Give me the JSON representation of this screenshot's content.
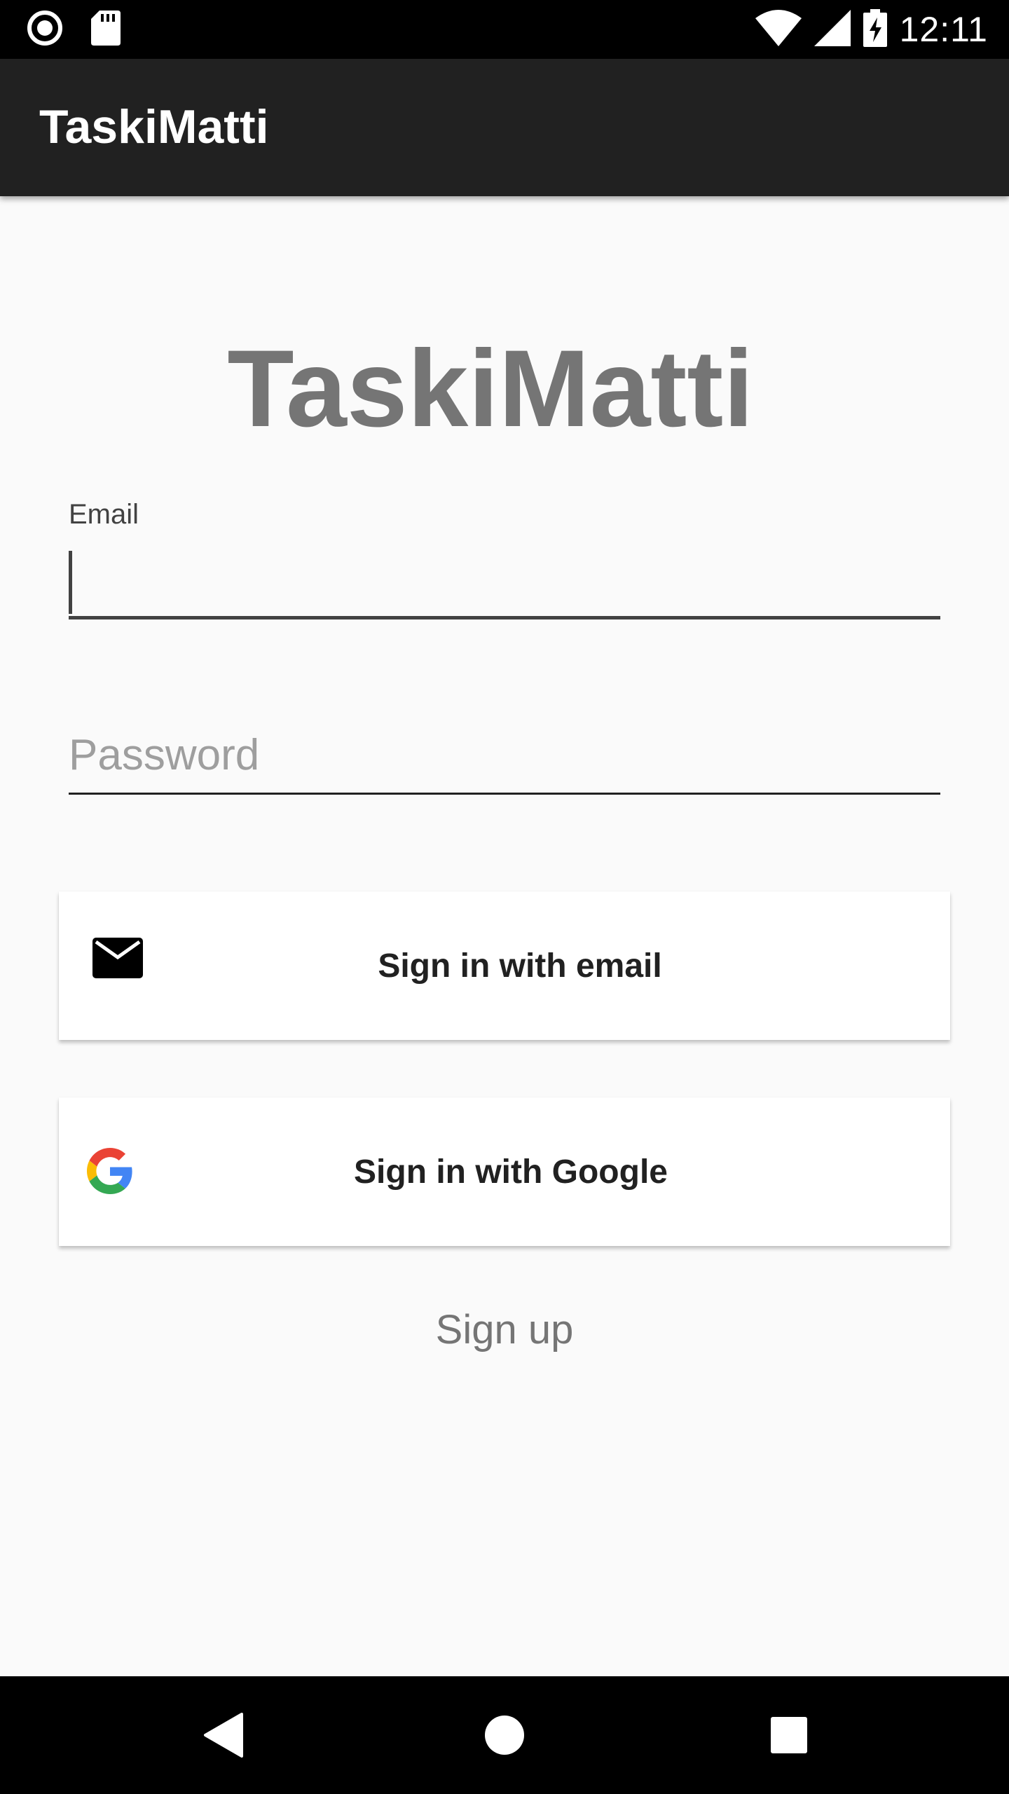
{
  "status_bar": {
    "time": "12:11",
    "icons": [
      "record-icon",
      "sd-card-icon",
      "wifi-icon",
      "signal-icon",
      "battery-charging-icon"
    ]
  },
  "app_bar": {
    "title": "TaskiMatti"
  },
  "hero": {
    "title": "TaskiMatti"
  },
  "form": {
    "email_label": "Email",
    "email_value": "",
    "password_placeholder": "Password"
  },
  "buttons": {
    "email_signin": {
      "label": "Sign in with email",
      "icon": "mail-icon"
    },
    "google_signin": {
      "label": "Sign in with Google",
      "icon": "google-g-icon"
    },
    "signup": "Sign up"
  },
  "nav_bar": {
    "icons": [
      "back-icon",
      "home-icon",
      "recents-icon"
    ]
  },
  "colors": {
    "app_bar": "#212121",
    "background": "#fafafa",
    "hero_text": "#757575",
    "google_blue": "#4285F4",
    "google_red": "#EA4335",
    "google_yellow": "#FBBC05",
    "google_green": "#34A853"
  }
}
